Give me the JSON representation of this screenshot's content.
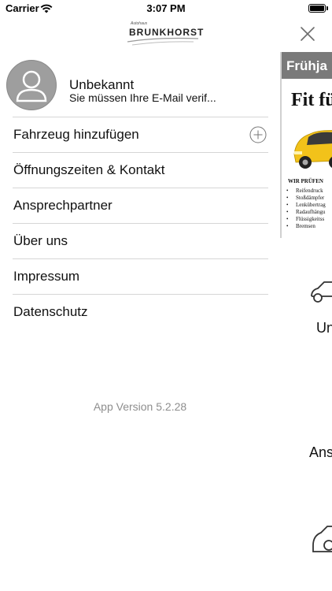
{
  "status_bar": {
    "carrier": "Carrier",
    "time": "3:07 PM"
  },
  "header": {
    "logo_small": "Autohaus",
    "logo_main": "BRUNKHORST"
  },
  "profile": {
    "name": "Unbekannt",
    "subtitle": "Sie müssen Ihre E-Mail verif..."
  },
  "menu": {
    "items": [
      {
        "label": "Fahrzeug hinzufügen",
        "icon": "plus-circle-icon"
      },
      {
        "label": "Öffnungszeiten & Kontakt"
      },
      {
        "label": "Ansprechpartner"
      },
      {
        "label": "Über uns"
      },
      {
        "label": "Impressum"
      },
      {
        "label": "Datenschutz"
      }
    ],
    "app_version": "App Version 5.2.28"
  },
  "peek": {
    "promo": {
      "banner": "Frühja",
      "heading": "Fit fü",
      "check_title": "WIR PRÜFEN",
      "checks": [
        "Reifendruck",
        "Stoßdämpfer",
        "Lenkübertrag",
        "Radaufhängu",
        "Flüssigkeitss",
        "Bremsen"
      ]
    },
    "label_1": "Un",
    "label_2": "Ans"
  },
  "colors": {
    "divider": "#d6d6d6",
    "secondary_text": "#8e8e8e",
    "avatar": "#9e9e9e",
    "promo_car": "#f2c21a"
  }
}
